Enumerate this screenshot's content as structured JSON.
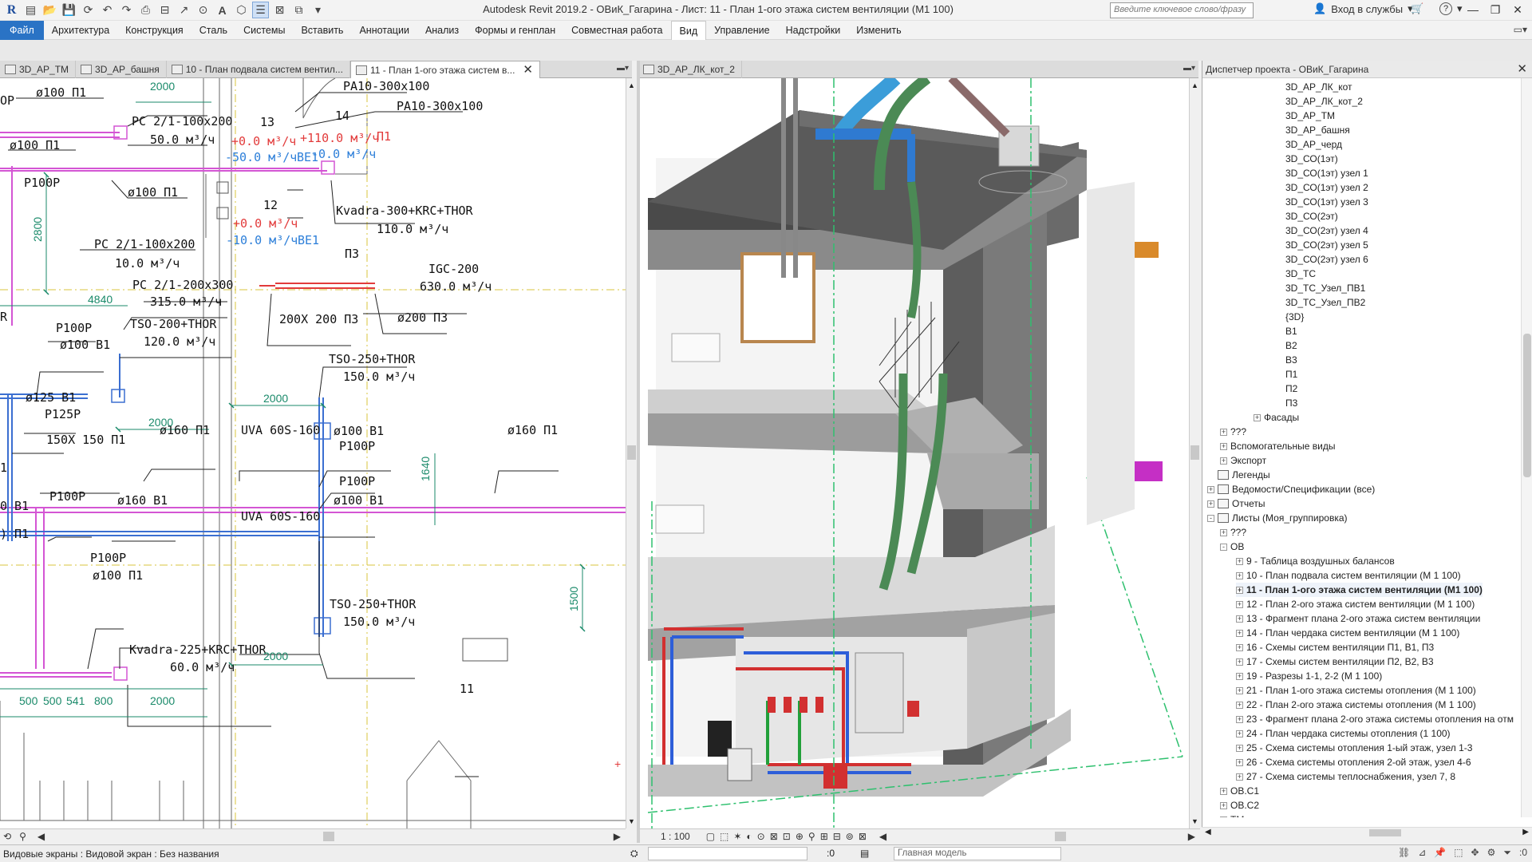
{
  "titlebar": {
    "app_title": "Autodesk Revit 2019.2 - ОВиК_Гагарина - Лист: 11 - План 1-ого этажа систем вентиляции (М1 100)",
    "search_placeholder": "Введите ключевое слово/фразу",
    "signin": "Вход в службы",
    "help": "?"
  },
  "menubar": {
    "file": "Файл",
    "items": [
      "Архитектура",
      "Конструкция",
      "Сталь",
      "Системы",
      "Вставить",
      "Аннотации",
      "Анализ",
      "Формы и генплан",
      "Совместная работа",
      "Вид",
      "Управление",
      "Надстройки",
      "Изменить"
    ],
    "active": "Вид"
  },
  "tabs_left": [
    {
      "label": "3D_АР_ТМ",
      "active": false
    },
    {
      "label": "3D_АР_башня",
      "active": false
    },
    {
      "label": "10 - План подвала систем вентил...",
      "active": false
    },
    {
      "label": "11 - План 1-ого этажа систем в...",
      "active": true
    }
  ],
  "tabs_right": [
    {
      "label": "3D_АР_ЛК_кот_2",
      "active": true
    }
  ],
  "plan": {
    "labels": {
      "pa1": "РА10-300х100",
      "pa2": "РА10-300х100",
      "d100p1_a": "ø100 П1",
      "pc1": "РС 2/1-100х200",
      "f50": "50.0 м³/ч",
      "d100p1_b": "ø100 П1",
      "p100p_a": "Р100Р",
      "d100p1_c": "ø100 П1",
      "r13": "13",
      "r14": "14",
      "p1": "П1",
      "red1": "+0.0 м³/ч",
      "red1b": "+110.0 м³/ч",
      "blue1": "-50.0 м³/ч",
      "blue1b": "-0.0 м³/ч",
      "be1": "ВЕ1",
      "kvadra300": "Kvadra-300+KRC+THOR",
      "f110": "110.0 м³/ч",
      "r12": "12",
      "red2": "+0.0 м³/ч",
      "blue2": "-10.0 м³/ч",
      "be1b": "ВЕ1",
      "pc2": "РС 2/1-100х200",
      "f10": "10.0 м³/ч",
      "p3": "П3",
      "igc": "IGC-200",
      "f630": "630.0 м³/ч",
      "pc3": "РС 2/1-200х300",
      "f315": "315.0 м³/ч",
      "d200x200": "200Х 200 П3",
      "d200p3": "ø200 П3",
      "p100p_b": "Р100Р",
      "tso200": "TSO-200+THOR",
      "f120": "120.0 м³/ч",
      "d100b1_a": "ø100 В1",
      "tso250a": "TSO-250+THOR",
      "f150a": "150.0 м³/ч",
      "d125b1": "ø125 В1",
      "p125p": "Р125Р",
      "d150x150": "150Х 150 П1",
      "d160p1_a": "ø160 П1",
      "uva1": "UVA 60S-160",
      "d100b1_b": "ø100 В1",
      "d160p1_b": "ø160 П1",
      "p100p_c": "Р100Р",
      "p100p_d": "Р100Р",
      "p100p_e": "Р100Р",
      "d160b1": "ø160 В1",
      "d100b1_c": "ø100 В1",
      "uva2": "UVA 60S-160",
      "b1left": "0 В1",
      "p1left": ") П1",
      "p100p_f": "Р100Р",
      "d100p1_d": "ø100 П1",
      "tso250b": "TSO-250+THOR",
      "f150b": "150.0 м³/ч",
      "kvadra225": "Kvadra-225+KRC+THOR",
      "f60": "60.0 м³/ч",
      "r11": "11",
      "op": "ОР",
      "r_left": "R",
      "one": "1"
    },
    "dims": {
      "d2000a": "2000",
      "d2800": "2800",
      "d4840": "4840",
      "d2000b": "2000",
      "d2000c": "2000",
      "d1640": "1640",
      "d1500": "1500",
      "d2000d": "2000",
      "d500a": "500",
      "d500b": "500",
      "d541": "541",
      "d800": "800",
      "d2000e": "2000"
    }
  },
  "view3d": {
    "scale": "1 : 100"
  },
  "browser": {
    "title": "Диспетчер проекта - ОВиК_Гагарина",
    "items": [
      {
        "label": "3D_АР_ЛК_кот",
        "indent": 4,
        "exp": ""
      },
      {
        "label": "3D_АР_ЛК_кот_2",
        "indent": 4,
        "exp": ""
      },
      {
        "label": "3D_АР_ТМ",
        "indent": 4,
        "exp": ""
      },
      {
        "label": "3D_АР_башня",
        "indent": 4,
        "exp": ""
      },
      {
        "label": "3D_АР_черд",
        "indent": 4,
        "exp": ""
      },
      {
        "label": "3D_СО(1эт)",
        "indent": 4,
        "exp": ""
      },
      {
        "label": "3D_СО(1эт) узел 1",
        "indent": 4,
        "exp": ""
      },
      {
        "label": "3D_СО(1эт) узел 2",
        "indent": 4,
        "exp": ""
      },
      {
        "label": "3D_СО(1эт) узел 3",
        "indent": 4,
        "exp": ""
      },
      {
        "label": "3D_СО(2эт)",
        "indent": 4,
        "exp": ""
      },
      {
        "label": "3D_СО(2эт) узел 4",
        "indent": 4,
        "exp": ""
      },
      {
        "label": "3D_СО(2эт) узел 5",
        "indent": 4,
        "exp": ""
      },
      {
        "label": "3D_СО(2эт) узел 6",
        "indent": 4,
        "exp": ""
      },
      {
        "label": "3D_ТС",
        "indent": 4,
        "exp": ""
      },
      {
        "label": "3D_ТС_Узел_ПВ1",
        "indent": 4,
        "exp": ""
      },
      {
        "label": "3D_ТС_Узел_ПВ2",
        "indent": 4,
        "exp": ""
      },
      {
        "label": "{3D}",
        "indent": 4,
        "exp": ""
      },
      {
        "label": "В1",
        "indent": 4,
        "exp": ""
      },
      {
        "label": "В2",
        "indent": 4,
        "exp": ""
      },
      {
        "label": "В3",
        "indent": 4,
        "exp": ""
      },
      {
        "label": "П1",
        "indent": 4,
        "exp": ""
      },
      {
        "label": "П2",
        "indent": 4,
        "exp": ""
      },
      {
        "label": "П3",
        "indent": 4,
        "exp": ""
      },
      {
        "label": "Фасады",
        "indent": 3,
        "exp": "+"
      },
      {
        "label": "???",
        "indent": 1,
        "exp": "+"
      },
      {
        "label": "Вспомогательные виды",
        "indent": 1,
        "exp": "+"
      },
      {
        "label": "Экспорт",
        "indent": 1,
        "exp": "+"
      },
      {
        "label": "Легенды",
        "indent": 0,
        "exp": "",
        "icon": true
      },
      {
        "label": "Ведомости/Спецификации (все)",
        "indent": 0,
        "exp": "+",
        "icon": true
      },
      {
        "label": "Отчеты",
        "indent": 0,
        "exp": "+",
        "icon": true
      },
      {
        "label": "Листы (Моя_группировка)",
        "indent": 0,
        "exp": "-",
        "icon": true
      },
      {
        "label": "???",
        "indent": 1,
        "exp": "+"
      },
      {
        "label": "ОВ",
        "indent": 1,
        "exp": "-"
      },
      {
        "label": "9 - Таблица воздушных балансов",
        "indent": 2,
        "exp": "+"
      },
      {
        "label": "10 - План подвала систем вентиляции (М 1 100)",
        "indent": 2,
        "exp": "+"
      },
      {
        "label": "11 - План 1-ого этажа систем вентиляции (М1 100)",
        "indent": 2,
        "exp": "+",
        "bold": true
      },
      {
        "label": "12 - План 2-ого этажа систем вентиляции (М 1 100)",
        "indent": 2,
        "exp": "+"
      },
      {
        "label": "13 - Фрагмент плана 2-ого этажа систем вентиляции",
        "indent": 2,
        "exp": "+"
      },
      {
        "label": "14 - План чердака систем вентиляции (М 1 100)",
        "indent": 2,
        "exp": "+"
      },
      {
        "label": "16 - Схемы систем вентиляции П1, В1, П3",
        "indent": 2,
        "exp": "+"
      },
      {
        "label": "17 - Схемы систем вентиляции П2, В2, В3",
        "indent": 2,
        "exp": "+"
      },
      {
        "label": "19 - Разрезы 1-1, 2-2 (М 1 100)",
        "indent": 2,
        "exp": "+"
      },
      {
        "label": "21 - План 1-ого этажа системы отопления (М 1 100)",
        "indent": 2,
        "exp": "+"
      },
      {
        "label": "22 - План 2-ого этажа системы отопления (М 1 100)",
        "indent": 2,
        "exp": "+"
      },
      {
        "label": "23 - Фрагмент плана 2-ого этажа системы отопления на отм",
        "indent": 2,
        "exp": "+"
      },
      {
        "label": "24 - План чердака системы отопления (1 100)",
        "indent": 2,
        "exp": "+"
      },
      {
        "label": "25 - Схема системы отопления 1-ый этаж, узел 1-3",
        "indent": 2,
        "exp": "+"
      },
      {
        "label": "26 - Схема системы отопления 2-ой этаж, узел 4-6",
        "indent": 2,
        "exp": "+"
      },
      {
        "label": "27 - Схема системы теплоснабжения, узел 7, 8",
        "indent": 2,
        "exp": "+"
      },
      {
        "label": "ОВ.С1",
        "indent": 1,
        "exp": "+"
      },
      {
        "label": "ОВ.С2",
        "indent": 1,
        "exp": "+"
      },
      {
        "label": "ТМ",
        "indent": 1,
        "exp": "+"
      }
    ]
  },
  "statusbar": {
    "text": "Видовые экраны : Видовой экран : Без названия",
    "zero": ":0",
    "model": "Главная модель",
    "filter": ":0"
  }
}
